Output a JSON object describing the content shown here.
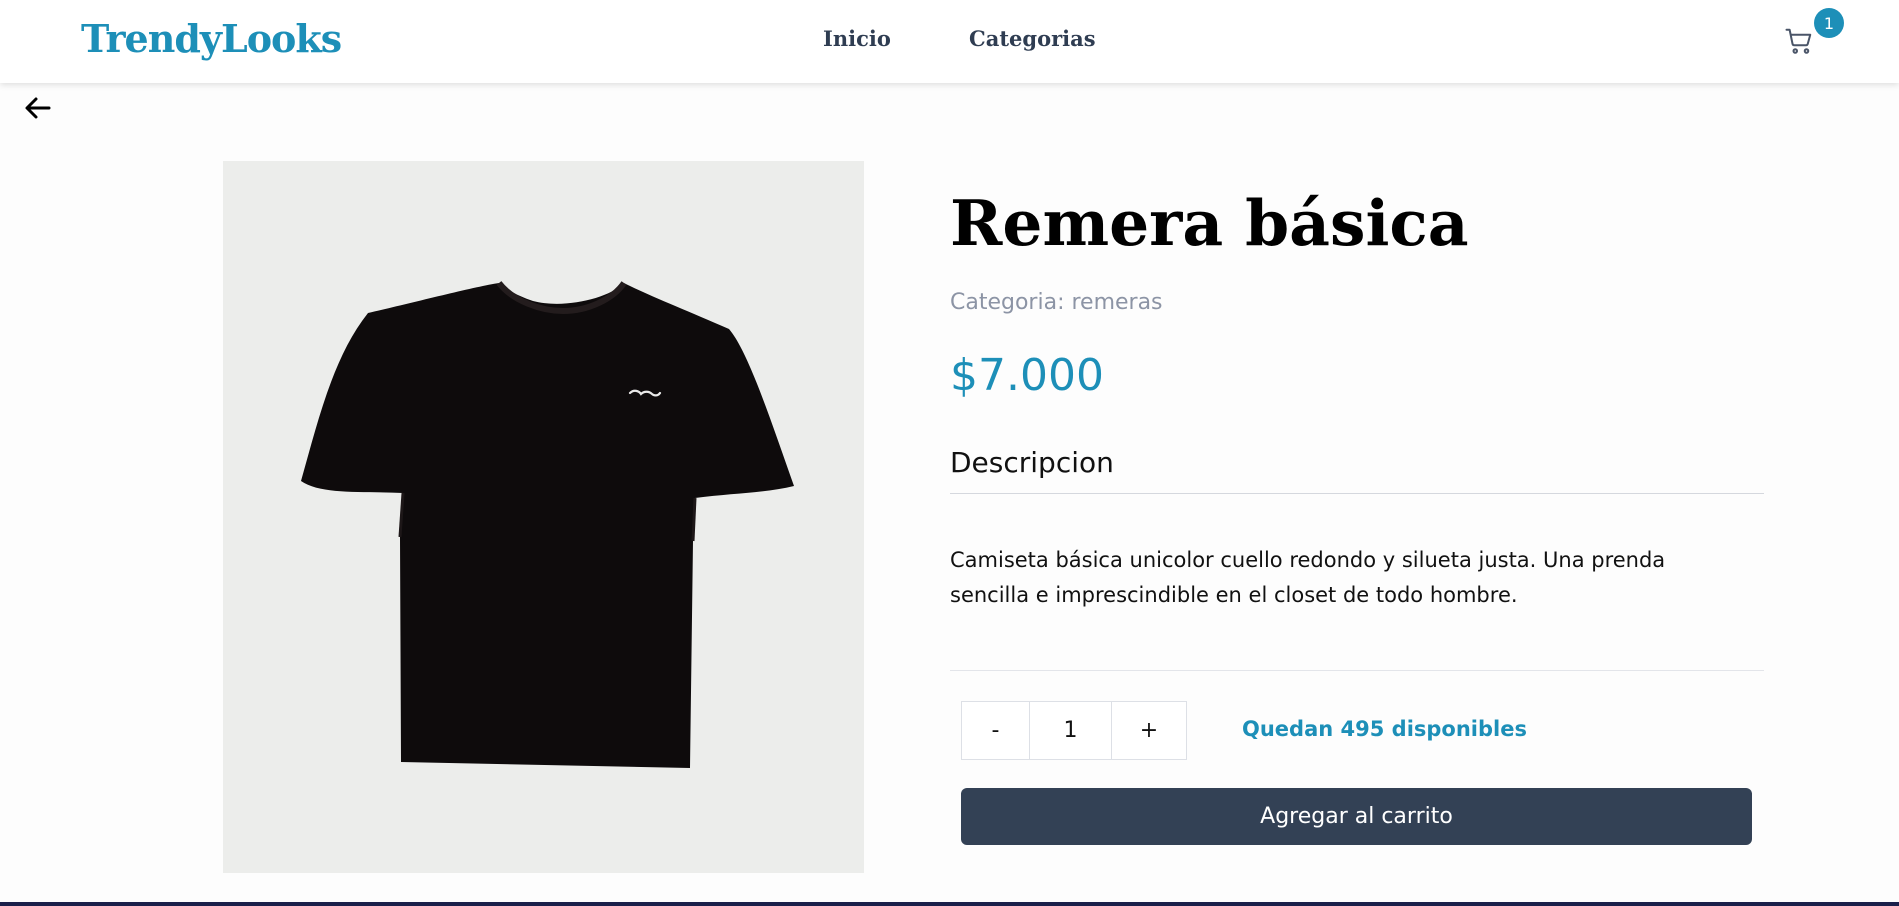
{
  "header": {
    "logo": "TrendyLooks",
    "nav": [
      {
        "label": "Inicio"
      },
      {
        "label": "Categorias"
      }
    ],
    "cart": {
      "icon": "cart-icon",
      "count": "1"
    }
  },
  "back": {
    "icon": "arrow-left-icon"
  },
  "product": {
    "title": "Remera básica",
    "category": "Categoria: remeras",
    "price": "$7.000",
    "description_heading": "Descripcion",
    "description": "Camiseta básica unicolor cuello redondo y silueta justa. Una prenda sencilla e imprescindible en el closet de todo hombre.",
    "quantity": {
      "minus": "-",
      "value": "1",
      "plus": "+"
    },
    "stock": "Quedan 495 disponibles",
    "add_to_cart": "Agregar al carrito"
  },
  "colors": {
    "accent": "#1d8fb8",
    "button": "#334155",
    "nav_text": "#2f3d52",
    "muted": "#8c94a5"
  }
}
